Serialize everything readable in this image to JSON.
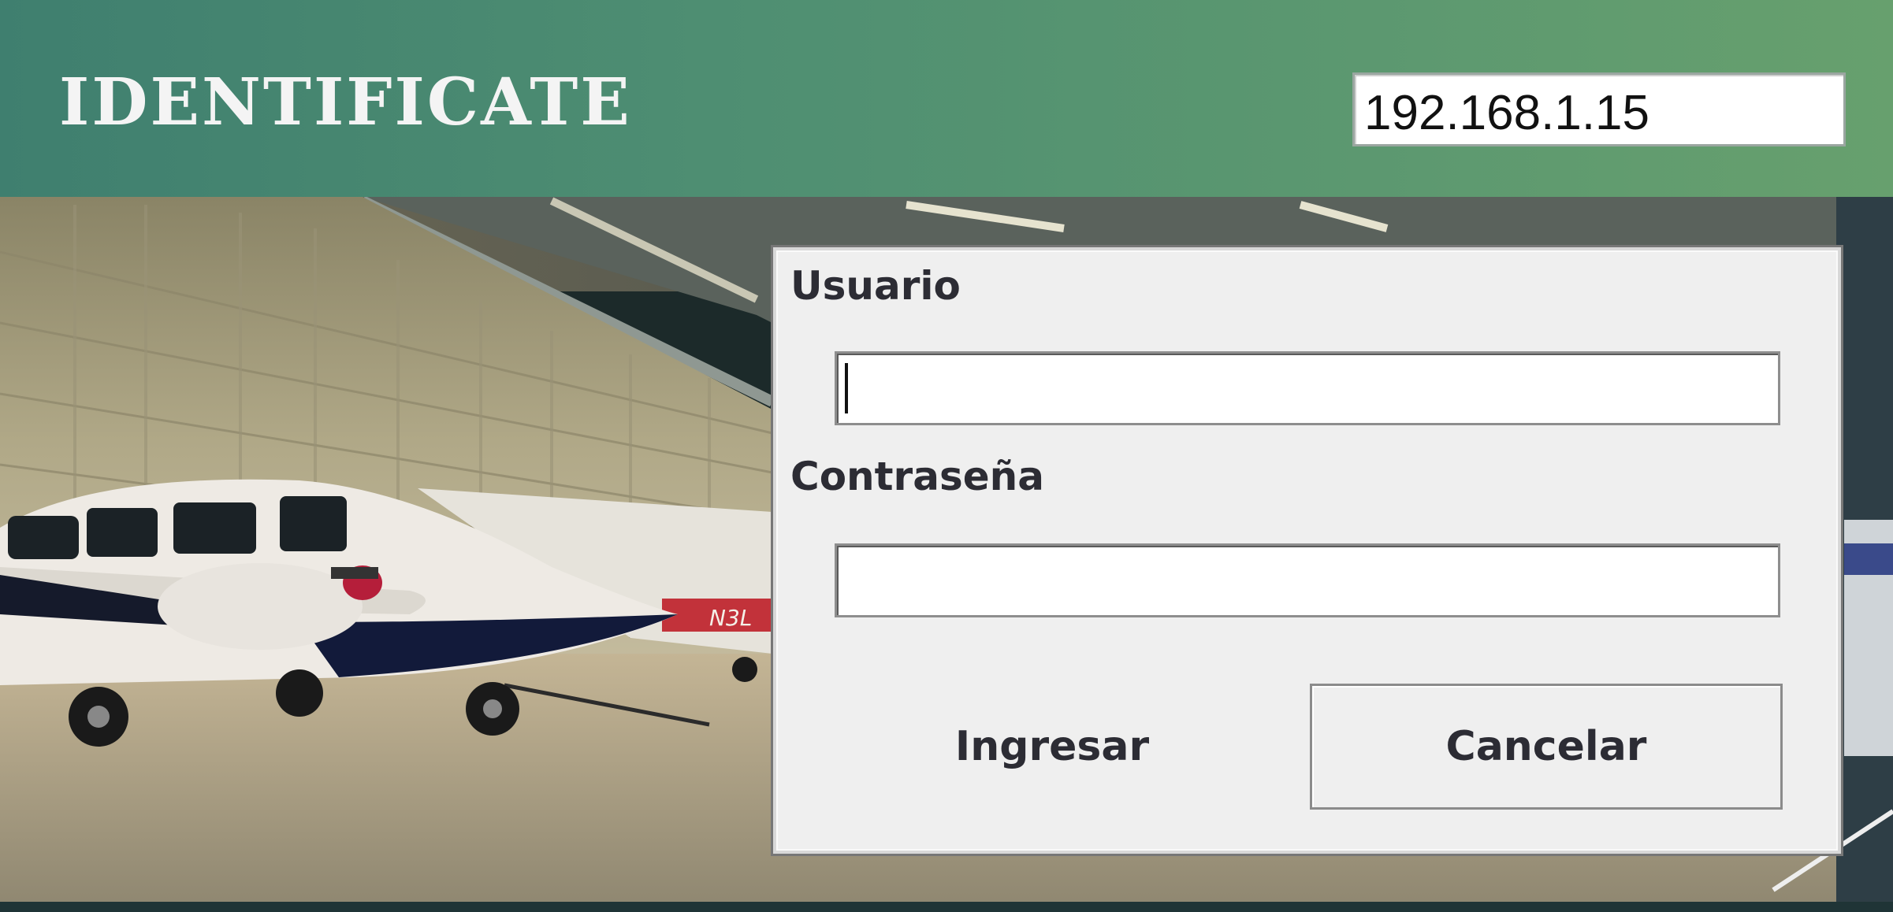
{
  "header": {
    "title": "IDENTIFICATE",
    "server_ip": "192.168.1.15"
  },
  "login": {
    "user_label": "Usuario",
    "user_value": "",
    "password_label": "Contraseña",
    "password_value": "",
    "submit_label": "Ingresar",
    "cancel_label": "Cancelar"
  },
  "background": {
    "aircraft_tail_text": "N3L"
  },
  "colors": {
    "header_start": "#3f7f6f",
    "header_end": "#67a06e",
    "panel_bg": "#efefef",
    "label_text": "#2c2c34"
  }
}
